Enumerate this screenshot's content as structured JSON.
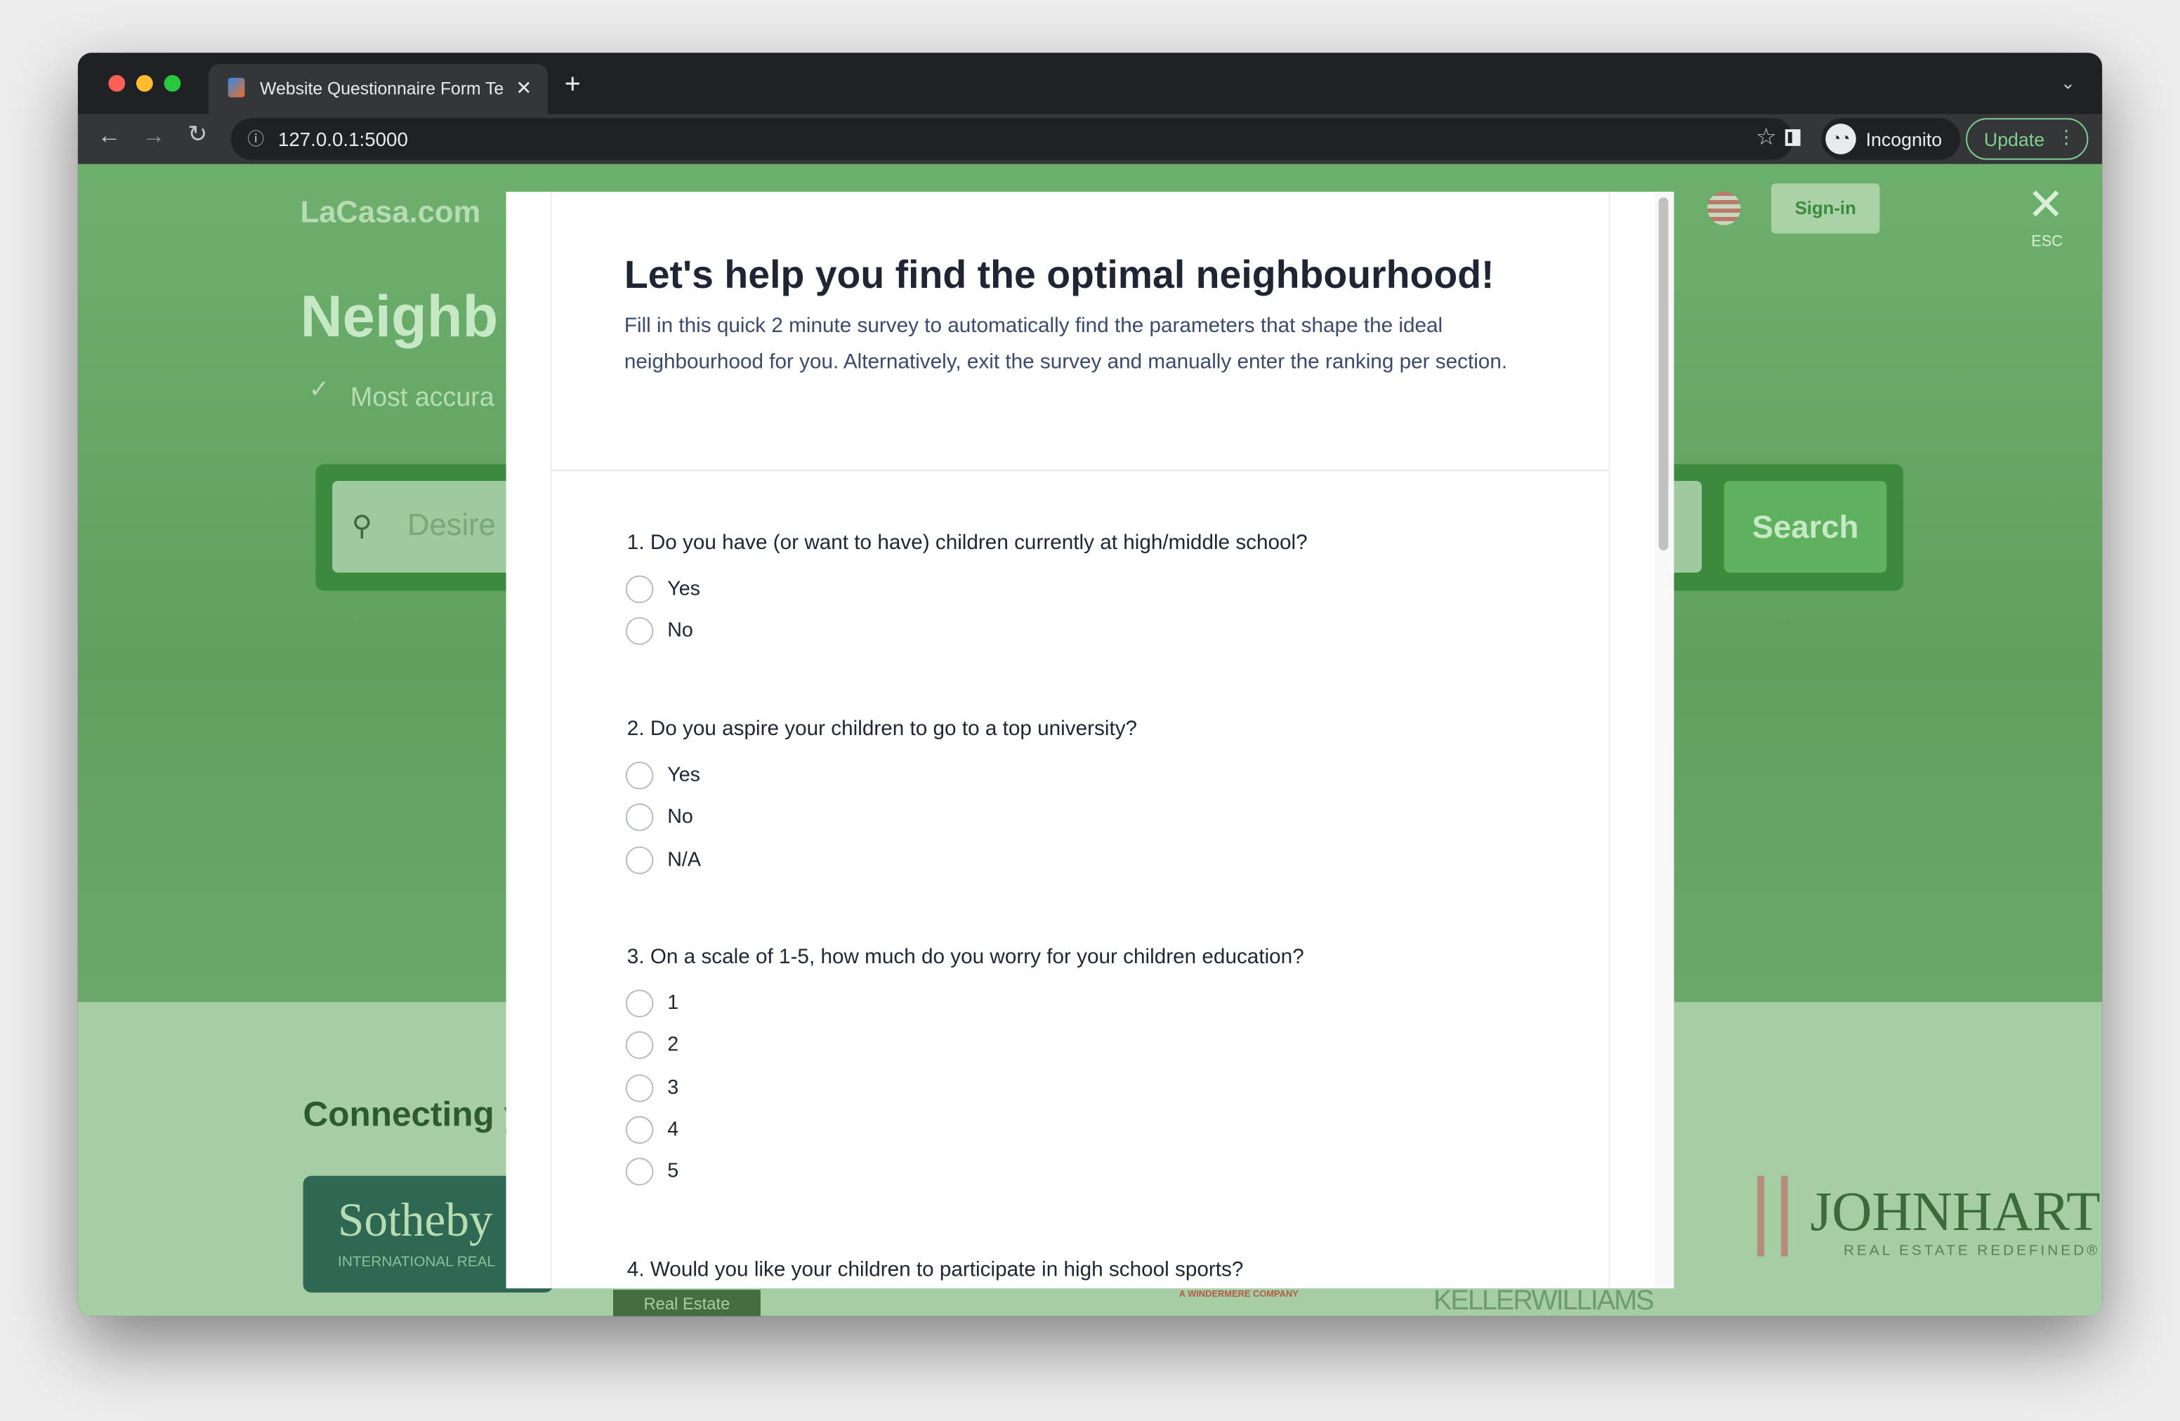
{
  "browser": {
    "tab_title": "Website Questionnaire Form Te",
    "url": "127.0.0.1:5000",
    "profile": "Incognito",
    "update_label": "Update"
  },
  "site": {
    "logo": "LaCasa.com",
    "hero_title": "Neighb",
    "hero_check_text": "Most accura",
    "search_placeholder": "Desire",
    "search_button": "Search",
    "signin": "Sign-in",
    "close_hint": "ESC",
    "connecting": "Connecting y",
    "partners": [
      "Sotheby",
      "INTERNATIONAL REAL",
      "Real Estate",
      "A WINDERMERE COMPANY",
      "KELLERWILLIAMS",
      "JOHNHART",
      "REAL ESTATE REDEFINED®"
    ]
  },
  "modal": {
    "title": "Let's help you find the optimal neighbourhood!",
    "description": "Fill in this quick 2 minute survey to automatically find the parameters that shape the ideal neighbourhood for you. Alternatively, exit the survey and manually enter the ranking per section.",
    "questions": [
      {
        "text": "1. Do you have (or want to have) children currently at high/middle school?",
        "options": [
          "Yes",
          "No"
        ]
      },
      {
        "text": "2. Do you aspire your children to go to a top university?",
        "options": [
          "Yes",
          "No",
          "N/A"
        ]
      },
      {
        "text": "3. On a scale of 1-5, how much do you worry for your children education?",
        "options": [
          "1",
          "2",
          "3",
          "4",
          "5"
        ]
      },
      {
        "text": "4. Would you like your children to participate in high school sports?",
        "options": []
      }
    ]
  },
  "colors": {
    "overlay_green": "#67a86a",
    "accent_green": "#4a9a4c"
  }
}
